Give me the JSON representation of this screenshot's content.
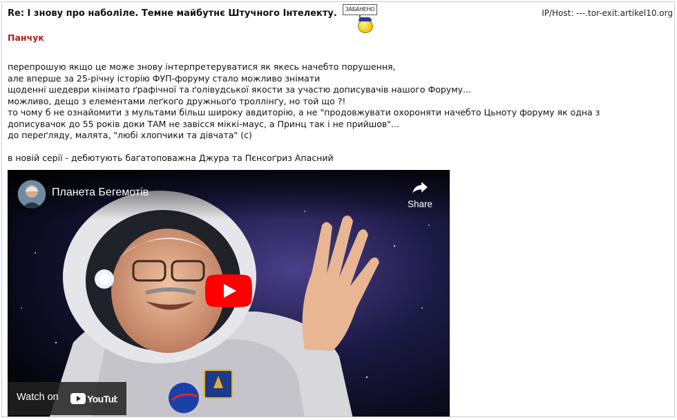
{
  "post": {
    "title": "Re: І знову про наболіле. Темне майбутнє Штучного Інтелекту.",
    "ip_host": "IP/Host: ---.tor-exit.artikel10.org",
    "banned_badge": "ЗАБАНЕНО",
    "author": "Панчук",
    "paragraphs": [
      "перепрошую якщо це може знову інтерпретеруватися як якесь начебто порушення,",
      "але вперше за 25-річну історію ФУП-форуму стало можливо знімати",
      "щоденні шедеври кінімато ґрафічної та ґолівудської якости за участю дописувачів нашого Форуму...",
      "можливо, дещо з елементами леґкоґо дружньоґо троллінґу, но той що ?!",
      "то чому б не ознайомити з мультами більш широку авдиторію, а не \"продовжувати охороняти начебто Цьноту форуму як одна з",
      "дописувачок до 55 років доки ТАМ не завісся міккі-маус, а Принц так і не прийшов\"...",
      "до переґляду, малята, \"любі хлопчики та дівчата\" (с)"
    ],
    "after_gap": "в новій серії - дебютують баґатоповажна Джура та Пєнсоґриз Апасний"
  },
  "video": {
    "channel_title": "Планета Бегемотів",
    "share_label": "Share",
    "watch_on_label": "Watch on",
    "youtube_logo_text": "YouTube",
    "colors": {
      "play_red": "#ff0000",
      "overlay": "#212121"
    },
    "icons": [
      "share-icon",
      "play-icon",
      "youtube-logo-icon",
      "channel-avatar"
    ]
  }
}
